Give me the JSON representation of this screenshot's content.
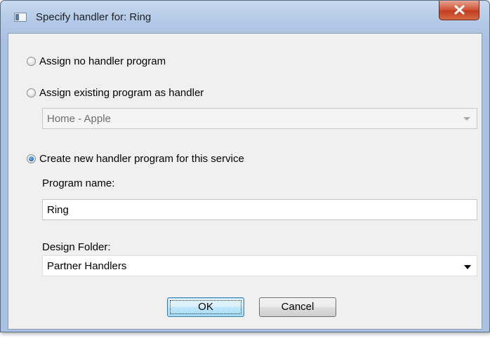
{
  "window": {
    "title": "Specify handler for: Ring",
    "icons": {
      "app": "window-app-icon",
      "close": "close-x-icon"
    }
  },
  "options": {
    "no_handler": {
      "label": "Assign no handler program",
      "checked": false
    },
    "existing": {
      "label": "Assign existing program as handler",
      "checked": false,
      "combo_value": "Home - Apple",
      "combo_enabled": false
    },
    "create_new": {
      "label": "Create new handler program for this service",
      "checked": true
    }
  },
  "program_name": {
    "label": "Program name:",
    "value": "Ring"
  },
  "design_folder": {
    "label": "Design Folder:",
    "value": "Partner Handlers"
  },
  "buttons": {
    "ok": "OK",
    "cancel": "Cancel"
  },
  "colors": {
    "selected_radio": "#1f69b8",
    "close_button": "#c23e1f",
    "frame": "#a9c1e2"
  }
}
